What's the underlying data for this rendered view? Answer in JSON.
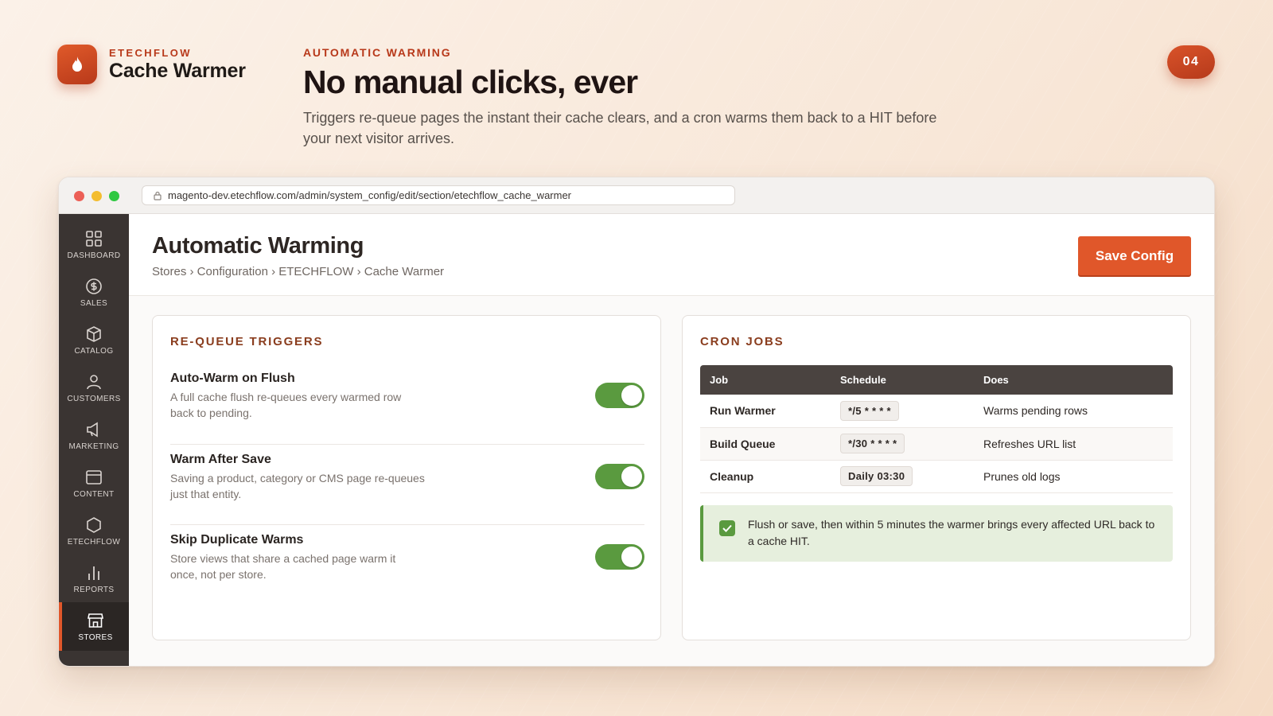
{
  "brand": {
    "kicker": "ETECHFLOW",
    "name": "Cache Warmer",
    "accent": "#d9532a"
  },
  "hero": {
    "kicker": "AUTOMATIC WARMING",
    "title": "No manual clicks, ever",
    "description": "Triggers re-queue pages the instant their cache clears, and a cron warms them back to a HIT before your next visitor arrives."
  },
  "slide_number": "04",
  "browser": {
    "url": "magento-dev.etechflow.com/admin/system_config/edit/section/etechflow_cache_warmer"
  },
  "sidebar": {
    "items": [
      {
        "label": "DASHBOARD",
        "icon": "grid-icon"
      },
      {
        "label": "SALES",
        "icon": "dollar-icon"
      },
      {
        "label": "CATALOG",
        "icon": "cube-icon"
      },
      {
        "label": "CUSTOMERS",
        "icon": "person-icon"
      },
      {
        "label": "MARKETING",
        "icon": "megaphone-icon"
      },
      {
        "label": "CONTENT",
        "icon": "layout-icon"
      },
      {
        "label": "ETECHFLOW",
        "icon": "hexagon-icon"
      },
      {
        "label": "REPORTS",
        "icon": "bar-chart-icon"
      },
      {
        "label": "STORES",
        "icon": "store-icon",
        "active": true
      }
    ]
  },
  "page": {
    "title": "Automatic Warming",
    "breadcrumb": "Stores › Configuration › ETECHFLOW › Cache Warmer",
    "save_label": "Save Config"
  },
  "triggers": {
    "title": "RE-QUEUE TRIGGERS",
    "items": [
      {
        "name": "Auto-Warm on Flush",
        "description": "A full cache flush re-queues every warmed row back to pending.",
        "enabled": true
      },
      {
        "name": "Warm After Save",
        "description": "Saving a product, category or CMS page re-queues just that entity.",
        "enabled": true
      },
      {
        "name": "Skip Duplicate Warms",
        "description": "Store views that share a cached page warm it once, not per store.",
        "enabled": true
      }
    ]
  },
  "cron": {
    "title": "CRON JOBS",
    "columns": [
      "Job",
      "Schedule",
      "Does"
    ],
    "rows": [
      {
        "job": "Run Warmer",
        "schedule": "*/5 * * * *",
        "does": "Warms pending rows"
      },
      {
        "job": "Build Queue",
        "schedule": "*/30 * * * *",
        "does": "Refreshes URL list"
      },
      {
        "job": "Cleanup",
        "schedule": "Daily 03:30",
        "does": "Prunes old logs"
      }
    ],
    "note": "Flush or save, then within 5 minutes the warmer brings every affected URL back to a cache HIT."
  }
}
